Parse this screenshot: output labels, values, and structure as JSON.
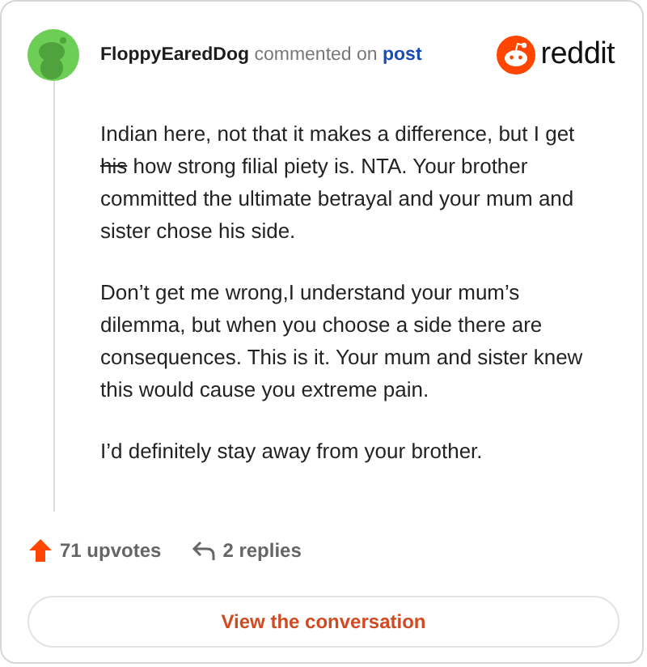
{
  "author": {
    "name": "FloppyEaredDog",
    "action": "commented on",
    "link": "post"
  },
  "brand": "reddit",
  "paragraphs": [
    [
      {
        "text": "Indian here, not that it makes a difference, but I get ",
        "struck": false
      },
      {
        "text": "his",
        "struck": true
      },
      {
        "text": " how strong filial piety is. NTA. Your brother committed the ultimate betrayal and your mum and sister chose his side.",
        "struck": false
      }
    ],
    [
      {
        "text": "Don’t get me wrong,I understand your mum’s dilemma, but when you choose a side there are consequences. This is it. Your mum and sister knew this would cause you extreme pain.",
        "struck": false
      }
    ],
    [
      {
        "text": "I’d definitely stay away from your brother.",
        "struck": false
      }
    ]
  ],
  "upvotes": "71 upvotes",
  "replies": "2 replies",
  "button": "View the conversation"
}
